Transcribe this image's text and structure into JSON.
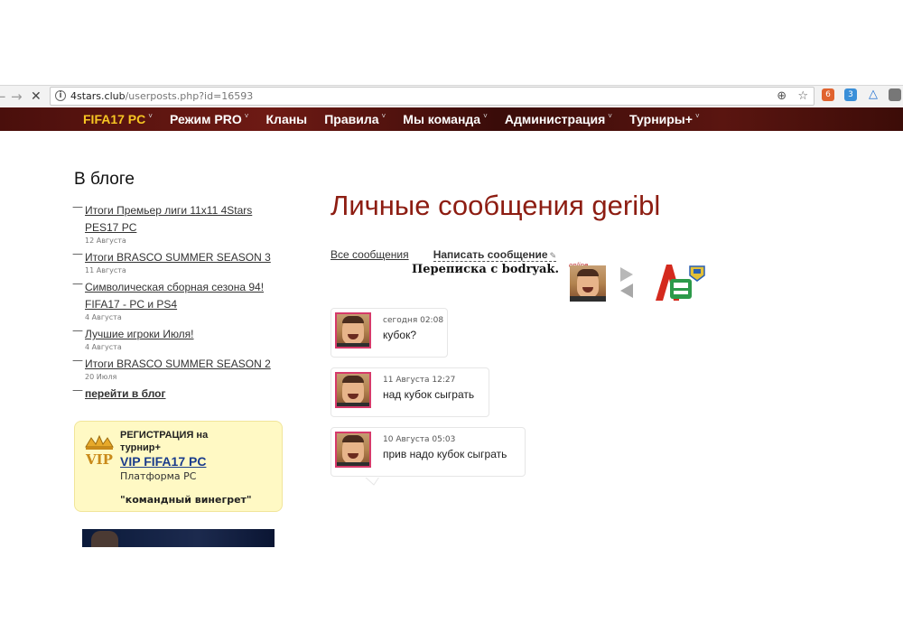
{
  "browser": {
    "back": "←",
    "forward": "→",
    "stop": "✕",
    "url_host": "4stars.club",
    "url_path": "/userposts.php?id=16593",
    "ext_badge_1": "6",
    "ext_badge_2": "3"
  },
  "site_menu": {
    "items": [
      {
        "label": "FIFA17 PC"
      },
      {
        "label": "Режим PRO"
      },
      {
        "label": "Кланы"
      },
      {
        "label": "Правила"
      },
      {
        "label": "Мы команда"
      },
      {
        "label": "Администрация"
      },
      {
        "label": "Турниры+"
      }
    ],
    "caret": "˅",
    "accent_color": "#f7c623"
  },
  "blog": {
    "title": "В блоге",
    "dash": "—",
    "items": [
      {
        "title": "Итоги Премьер лиги 11x11 4Stars PES17 PC",
        "date": "12 Августа"
      },
      {
        "title": "Итоги BRASCO SUMMER SEASON 3",
        "date": "11 Августа"
      },
      {
        "title": "Символическая сборная сезона 94! FIFA17 - PC и PS4",
        "date": "4 Августа"
      },
      {
        "title": "Лучшие игроки Июля!",
        "date": "4 Августа"
      },
      {
        "title": "Итоги BRASCO SUMMER SEASON 2",
        "date": "20 Июля"
      }
    ],
    "more_link": "перейти в блог"
  },
  "vip": {
    "logo_text": "VIP",
    "reg_line1": "РЕГИСТРАЦИЯ на",
    "reg_line2": "турнир+",
    "link": "VIP FIFA17 PC",
    "platform": "Платформа PC",
    "tagline": "\"командный винегрет\""
  },
  "main": {
    "title": "Личные сообщения geribl",
    "tab_all": "Все сообщения",
    "tab_write": "Написать сообщение",
    "correspondence": "Переписка с bodryak.",
    "online_label": "online",
    "title_color": "#8d1d12"
  },
  "messages": [
    {
      "date": "сегодня 02:08",
      "text": "кубок?"
    },
    {
      "date": "11 Августа 12:27",
      "text": "над кубок сыграть"
    },
    {
      "date": "10 Августа 05:03",
      "text": "прив надо кубок сыграть"
    }
  ]
}
